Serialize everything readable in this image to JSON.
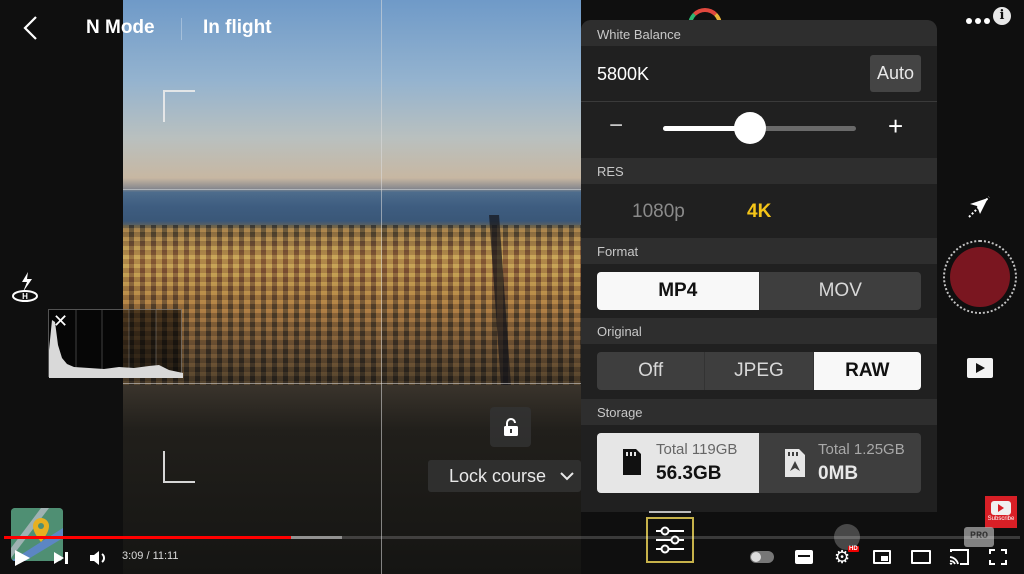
{
  "top_bar": {
    "mode": "N Mode",
    "flight_status": "In flight"
  },
  "panel": {
    "white_balance": {
      "label": "White Balance",
      "value": "5800K",
      "auto_label": "Auto",
      "slider_fraction": 0.45,
      "minus": "−",
      "plus": "+"
    },
    "res": {
      "label": "RES",
      "options": [
        "1080p",
        "4K"
      ],
      "selected": "4K",
      "accent": "#f5c518"
    },
    "format": {
      "label": "Format",
      "options": [
        "MP4",
        "MOV"
      ],
      "selected": "MP4"
    },
    "original": {
      "label": "Original",
      "options": [
        "Off",
        "JPEG",
        "RAW"
      ],
      "selected": "RAW"
    },
    "storage": {
      "label": "Storage",
      "sd_card": {
        "total": "Total 119GB",
        "free": "56.3GB",
        "selected": true
      },
      "internal": {
        "total": "Total 1.25GB",
        "free": "0MB",
        "selected": false
      }
    }
  },
  "overlay": {
    "lock_course_label": "Lock course"
  },
  "right_rail": {
    "pro_label": "PRO"
  },
  "youtube": {
    "time": "3:09 / 11:11",
    "progress_fraction": 0.282,
    "buffer_fraction": 0.333,
    "subscribe_label": "Subscribe",
    "hd_badge": "HD",
    "progress_color": "#ff0000"
  }
}
